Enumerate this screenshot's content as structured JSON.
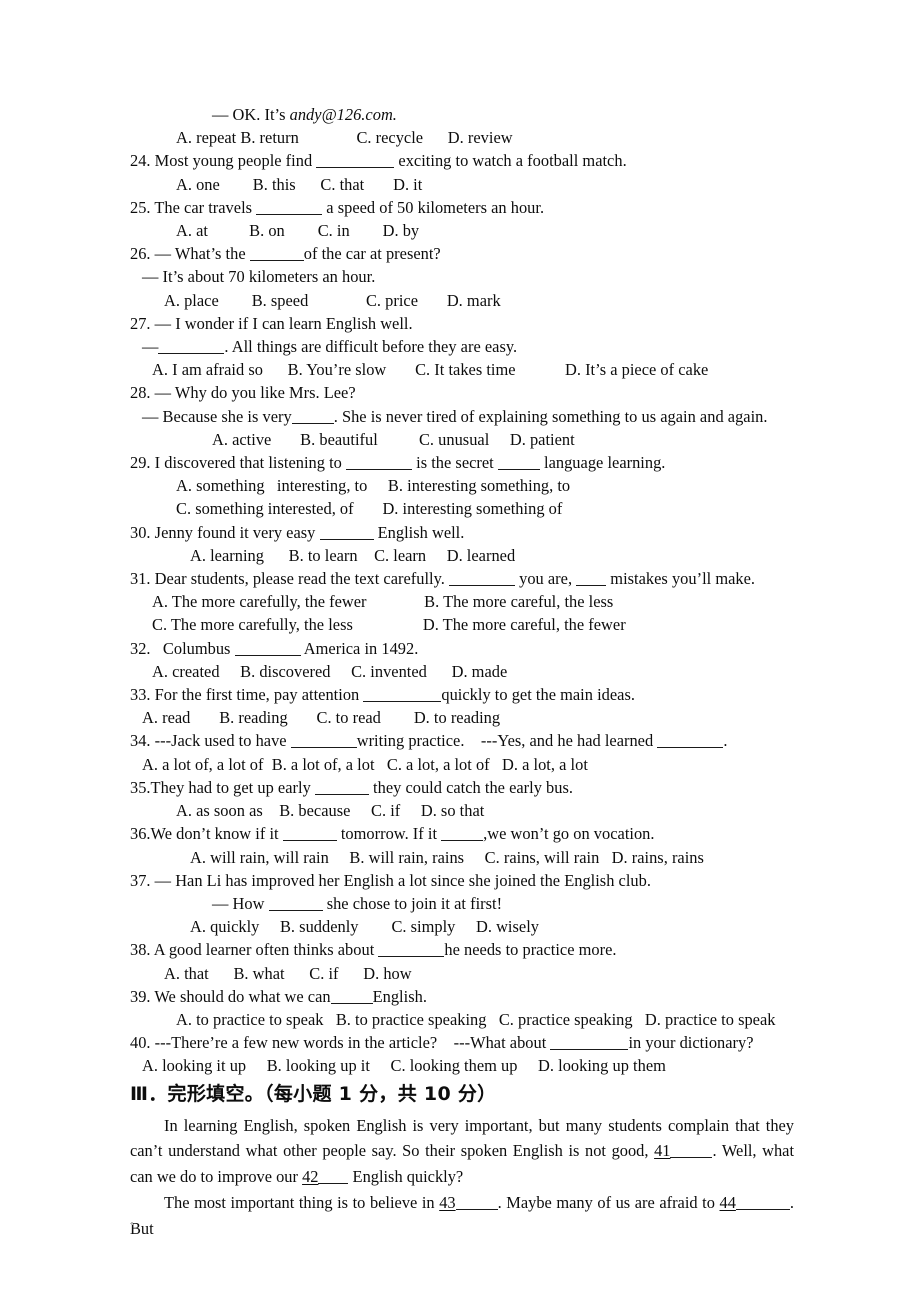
{
  "document": {
    "type": "english-exam-paper",
    "page_background": "#ffffff",
    "text_color": "#0d0d0d"
  },
  "q23_tail": {
    "dialogue_line": "— OK. It’s ",
    "email": "andy@126.com.",
    "options": "A. repeat B. return              C. recycle      D. review"
  },
  "questions": [
    {
      "id": "q24",
      "stem_pre": "24. Most young people find ",
      "stem_post": " exciting to watch a football match.",
      "options": "A. one        B. this      C. that       D. it"
    },
    {
      "id": "q25",
      "stem_pre": "25. The car travels ",
      "stem_post": " a speed of 50 kilometers an hour.",
      "options": "A. at          B. on        C. in        D. by"
    },
    {
      "id": "q26",
      "stem_pre": "26. — What’s the ",
      "stem_post": "of the car at present?",
      "reply": "— It’s about 70 kilometers an hour.",
      "options": "A. place        B. speed              C. price       D. mark"
    },
    {
      "id": "q27",
      "stem": "27. — I wonder if I can learn English well.",
      "reply_pre": "—",
      "reply_post": ". All things are difficult before they are easy.",
      "options": "A. I am afraid so      B. You’re slow       C. It takes time            D. It’s a piece of cake"
    },
    {
      "id": "q28",
      "stem": "28. — Why do you like Mrs. Lee?",
      "reply_pre": "— Because she is very",
      "reply_post": ". She is never tired of explaining something to us again and again.",
      "options": "A. active       B. beautiful          C. unusual     D. patient"
    },
    {
      "id": "q29",
      "stem_pre": "29. I discovered that listening to ",
      "stem_mid": " is the secret ",
      "stem_post": " language learning.",
      "options_ab": "A. something   interesting, to     B. interesting something, to",
      "options_cd": "C. something interested, of       D. interesting something of"
    },
    {
      "id": "q30",
      "stem_pre": "30. Jenny found it very easy ",
      "stem_post": " English well.",
      "options": "A. learning      B. to learn    C. learn     D. learned"
    },
    {
      "id": "q31",
      "stem_pre": "31. Dear students, please read the text carefully. ",
      "stem_mid": " you are, ",
      "stem_post": " mistakes you’ll make.",
      "options_ab": "A. The more carefully, the fewer              B. The more careful, the less",
      "options_cd": "C. The more carefully, the less                 D. The more careful, the fewer"
    },
    {
      "id": "q32",
      "stem_pre": "32.   Columbus ",
      "stem_post": " America in 1492.",
      "options": "A. created     B. discovered     C. invented      D. made"
    },
    {
      "id": "q33",
      "stem_pre": "33. For the first time, pay attention ",
      "stem_post": "quickly to get the main ideas.",
      "options": "A. read       B. reading       C. to read        D. to reading"
    },
    {
      "id": "q34",
      "stem_pre": "34. ---Jack used to have ",
      "stem_mid": "writing practice.    ---Yes, and he had learned ",
      "stem_post": ".",
      "options": "A. a lot of, a lot of  B. a lot of, a lot   C. a lot, a lot of   D. a lot, a lot"
    },
    {
      "id": "q35",
      "stem_pre": "35.They had to get up early ",
      "stem_post": " they could catch the early bus.",
      "options": "A. as soon as    B. because     C. if     D. so that"
    },
    {
      "id": "q36",
      "stem_pre": "36.We don’t know if it ",
      "stem_mid": " tomorrow. If it ",
      "stem_post": ",we won’t go on vocation.",
      "options": "A. will rain, will rain     B. will rain, rains     C. rains, will rain   D. rains, rains"
    },
    {
      "id": "q37",
      "stem": "37. — Han Li has improved her English a lot since she joined the English club.",
      "reply_pre": "— How ",
      "reply_post": " she chose to join it at first!",
      "options": "A. quickly     B. suddenly        C. simply     D. wisely"
    },
    {
      "id": "q38",
      "stem_pre": "38. A good learner often thinks about ",
      "stem_post": "he needs to practice more.",
      "options": "A. that      B. what      C. if      D. how"
    },
    {
      "id": "q39",
      "stem_pre": "39. We should do what we can",
      "stem_post": "English.",
      "options": "A. to practice to speak   B. to practice speaking   C. practice speaking   D. practice to speak"
    },
    {
      "id": "q40",
      "stem_pre": "40. ---There’re a few new words in the article?    ---What about ",
      "stem_post": "in your dictionary?",
      "options": "A. looking it up     B. looking up it     C. looking them up     D. looking up them"
    }
  ],
  "section_iii": {
    "heading": "Ⅲ．完形填空。（每小题 1 分，共 10 分）",
    "paragraph1": {
      "part1": "In learning English, spoken English is very important, but many students complain that they can’t understand what other people say. So their spoken English is not good, ",
      "blank41": "41",
      "part2": ". Well, what can we do to improve our ",
      "blank42": "42",
      "part3": " English quickly?"
    },
    "paragraph2": {
      "part1": "The most important thing is to believe in ",
      "blank43": "43",
      "part2": ". Maybe many of us are afraid to ",
      "blank44": "44",
      "part3": ". But"
    }
  }
}
